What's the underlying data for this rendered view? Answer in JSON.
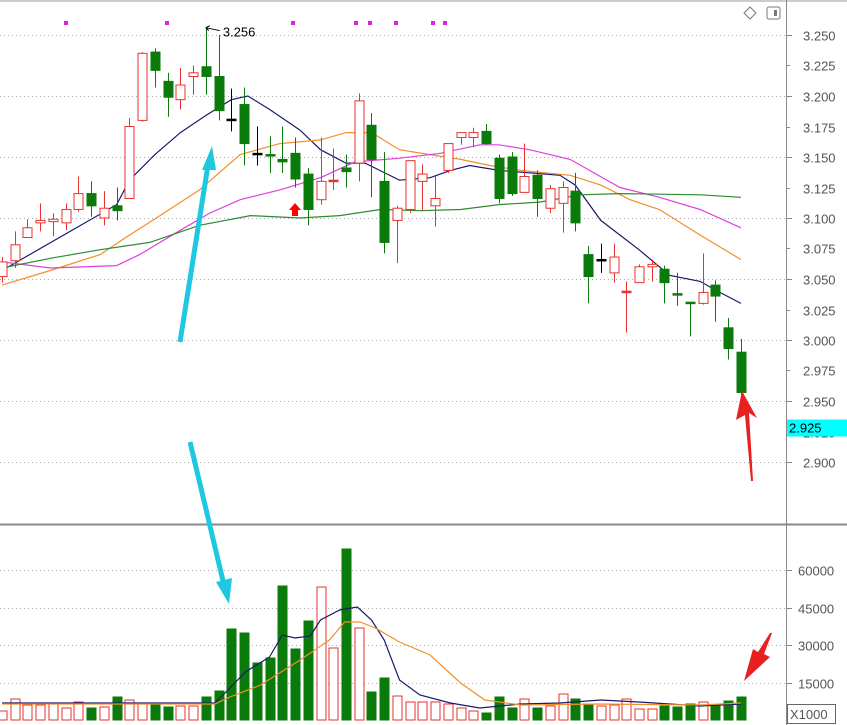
{
  "chart_data": {
    "type": "candlestick",
    "price_axis": {
      "ylim": [
        2.862,
        3.279
      ],
      "ticks": [
        "3.250",
        "3.225",
        "3.200",
        "3.175",
        "3.150",
        "3.125",
        "3.100",
        "3.075",
        "3.050",
        "3.025",
        "3.000",
        "2.975",
        "2.950",
        "2.925",
        "2.900"
      ],
      "grid_every": 0.05
    },
    "current_price_label": "2.925",
    "current_price_value": 2.925,
    "high_marker": {
      "label": "3.256",
      "index": 16,
      "value": 3.256
    },
    "colors": {
      "up": "#e8322e",
      "down": "#0a7a0a",
      "doji": "#000000",
      "ma5": "#1a1a6e",
      "ma10": "#f0902a",
      "ma20": "#e040e0",
      "ma60": "#2e8b2e",
      "current_price_bg": "#00ffff",
      "annotation_arrow": "#1ec8e0",
      "red_arrow": "#e82020",
      "marker_dot": "#e020e0"
    },
    "candles": [
      [
        3.052,
        3.068,
        3.047,
        3.064
      ],
      [
        3.065,
        3.089,
        3.059,
        3.078
      ],
      [
        3.084,
        3.099,
        3.084,
        3.092
      ],
      [
        3.096,
        3.112,
        3.089,
        3.098
      ],
      [
        3.097,
        3.104,
        3.085,
        3.099
      ],
      [
        3.096,
        3.112,
        3.09,
        3.107
      ],
      [
        3.107,
        3.134,
        3.105,
        3.12
      ],
      [
        3.12,
        3.13,
        3.101,
        3.11
      ],
      [
        3.1,
        3.122,
        3.094,
        3.108
      ],
      [
        3.11,
        3.125,
        3.098,
        3.106
      ],
      [
        3.116,
        3.182,
        3.116,
        3.175
      ],
      [
        3.18,
        3.236,
        3.179,
        3.235
      ],
      [
        3.236,
        3.239,
        3.207,
        3.221
      ],
      [
        3.212,
        3.219,
        3.183,
        3.199
      ],
      [
        3.197,
        3.223,
        3.189,
        3.209
      ],
      [
        3.216,
        3.225,
        3.201,
        3.219
      ],
      [
        3.224,
        3.256,
        3.201,
        3.216
      ],
      [
        3.216,
        3.25,
        3.18,
        3.188
      ],
      [
        3.181,
        3.206,
        3.171,
        3.181
      ],
      [
        3.193,
        3.207,
        3.143,
        3.161
      ],
      [
        3.153,
        3.175,
        3.143,
        3.153
      ],
      [
        3.152,
        3.167,
        3.137,
        3.151
      ],
      [
        3.148,
        3.175,
        3.137,
        3.146
      ],
      [
        3.153,
        3.166,
        3.125,
        3.132
      ],
      [
        3.136,
        3.141,
        3.094,
        3.107
      ],
      [
        3.115,
        3.166,
        3.111,
        3.13
      ],
      [
        3.131,
        3.157,
        3.123,
        3.131
      ],
      [
        3.141,
        3.152,
        3.125,
        3.138
      ],
      [
        3.145,
        3.202,
        3.13,
        3.196
      ],
      [
        3.176,
        3.186,
        3.117,
        3.148
      ],
      [
        3.13,
        3.154,
        3.071,
        3.08
      ],
      [
        3.098,
        3.11,
        3.063,
        3.108
      ],
      [
        3.107,
        3.147,
        3.104,
        3.147
      ],
      [
        3.13,
        3.144,
        3.106,
        3.136
      ],
      [
        3.11,
        3.134,
        3.093,
        3.116
      ],
      [
        3.139,
        3.161,
        3.137,
        3.161
      ],
      [
        3.166,
        3.17,
        3.16,
        3.17
      ],
      [
        3.166,
        3.174,
        3.158,
        3.17
      ],
      [
        3.171,
        3.177,
        3.16,
        3.161
      ],
      [
        3.149,
        3.152,
        3.112,
        3.116
      ],
      [
        3.15,
        3.154,
        3.118,
        3.12
      ],
      [
        3.121,
        3.161,
        3.121,
        3.134
      ],
      [
        3.135,
        3.139,
        3.101,
        3.116
      ],
      [
        3.108,
        3.127,
        3.104,
        3.124
      ],
      [
        3.112,
        3.13,
        3.088,
        3.125
      ],
      [
        3.122,
        3.137,
        3.089,
        3.096
      ],
      [
        3.07,
        3.077,
        3.03,
        3.052
      ],
      [
        3.066,
        3.079,
        3.055,
        3.066
      ],
      [
        3.055,
        3.079,
        3.047,
        3.068
      ],
      [
        3.039,
        3.048,
        3.006,
        3.04
      ],
      [
        3.047,
        3.062,
        3.047,
        3.06
      ],
      [
        3.06,
        3.066,
        3.048,
        3.062
      ],
      [
        3.058,
        3.061,
        3.03,
        3.047
      ],
      [
        3.038,
        3.055,
        3.028,
        3.037
      ],
      [
        3.031,
        3.031,
        3.003,
        3.03
      ],
      [
        3.03,
        3.071,
        3.029,
        3.039
      ],
      [
        3.045,
        3.049,
        3.015,
        3.036
      ],
      [
        3.01,
        3.018,
        2.984,
        2.993
      ],
      [
        2.99,
        3.001,
        2.955,
        2.957
      ]
    ],
    "moving_averages": [
      {
        "name": "MA5",
        "points": [
          [
            0,
            3.057
          ],
          [
            9,
            3.111
          ],
          [
            10,
            3.131
          ],
          [
            12,
            3.152
          ],
          [
            14,
            3.17
          ],
          [
            16,
            3.184
          ],
          [
            18,
            3.197
          ],
          [
            19.3,
            3.2
          ],
          [
            21,
            3.189
          ],
          [
            23.4,
            3.172
          ],
          [
            25,
            3.156
          ],
          [
            27,
            3.145
          ],
          [
            28.5,
            3.145
          ],
          [
            31.2,
            3.131
          ],
          [
            33.6,
            3.133
          ],
          [
            35.2,
            3.139
          ],
          [
            36.7,
            3.143
          ],
          [
            39,
            3.139
          ],
          [
            43.8,
            3.135
          ],
          [
            45,
            3.127
          ],
          [
            47,
            3.098
          ],
          [
            50,
            3.074
          ],
          [
            52.4,
            3.053
          ],
          [
            54.8,
            3.048
          ],
          [
            56,
            3.041
          ],
          [
            58,
            3.03
          ]
        ]
      },
      {
        "name": "MA10",
        "points": [
          [
            0,
            3.045
          ],
          [
            3.8,
            3.057
          ],
          [
            7.7,
            3.07
          ],
          [
            10,
            3.086
          ],
          [
            12.4,
            3.102
          ],
          [
            15.5,
            3.123
          ],
          [
            18.7,
            3.152
          ],
          [
            21.8,
            3.161
          ],
          [
            25,
            3.164
          ],
          [
            27,
            3.17
          ],
          [
            29,
            3.17
          ],
          [
            31.2,
            3.156
          ],
          [
            33.6,
            3.152
          ],
          [
            36,
            3.148
          ],
          [
            38.3,
            3.143
          ],
          [
            40.7,
            3.139
          ],
          [
            44.6,
            3.135
          ],
          [
            47,
            3.127
          ],
          [
            49.3,
            3.115
          ],
          [
            51.6,
            3.107
          ],
          [
            54.8,
            3.086
          ],
          [
            58,
            3.066
          ]
        ]
      },
      {
        "name": "MA20",
        "points": [
          [
            0,
            3.064
          ],
          [
            3.8,
            3.059
          ],
          [
            9,
            3.061
          ],
          [
            10.8,
            3.07
          ],
          [
            14,
            3.09
          ],
          [
            16.3,
            3.104
          ],
          [
            18.7,
            3.115
          ],
          [
            21.8,
            3.123
          ],
          [
            25,
            3.133
          ],
          [
            27.7,
            3.146
          ],
          [
            31.2,
            3.149
          ],
          [
            34.4,
            3.153
          ],
          [
            37.5,
            3.16
          ],
          [
            39,
            3.16
          ],
          [
            41.4,
            3.156
          ],
          [
            44.6,
            3.148
          ],
          [
            48.5,
            3.125
          ],
          [
            51.6,
            3.117
          ],
          [
            54.8,
            3.107
          ],
          [
            58,
            3.092
          ]
        ]
      },
      {
        "name": "MA60",
        "points": [
          [
            0,
            3.059
          ],
          [
            3.8,
            3.067
          ],
          [
            7.7,
            3.074
          ],
          [
            11.6,
            3.08
          ],
          [
            15.5,
            3.094
          ],
          [
            19.5,
            3.102
          ],
          [
            23.4,
            3.1
          ],
          [
            26.5,
            3.102
          ],
          [
            29.7,
            3.107
          ],
          [
            32.8,
            3.106
          ],
          [
            36,
            3.107
          ],
          [
            39,
            3.111
          ],
          [
            42.2,
            3.113
          ],
          [
            45.4,
            3.119
          ],
          [
            48.5,
            3.12
          ],
          [
            54.8,
            3.119
          ],
          [
            58,
            3.117
          ]
        ]
      }
    ],
    "volume": {
      "unit_label": "X1000",
      "ylim": [
        0,
        72000
      ],
      "ticks": [
        "60000",
        "45000",
        "30000",
        "15000"
      ],
      "tick_values": [
        60000,
        45000,
        30000,
        15000
      ],
      "values": [
        3600,
        8400,
        6000,
        6000,
        6400,
        4800,
        7200,
        4800,
        5200,
        9200,
        8000,
        6400,
        6800,
        5200,
        5600,
        5600,
        9200,
        11600,
        36400,
        34800,
        22800,
        24800,
        53600,
        28400,
        39600,
        53200,
        28800,
        68400,
        36800,
        11200,
        16800,
        9600,
        7200,
        7200,
        7200,
        6400,
        4800,
        3600,
        2800,
        9200,
        4800,
        8400,
        4800,
        5600,
        10400,
        8400,
        6400,
        5600,
        6000,
        8400,
        4400,
        4400,
        5600,
        5200,
        6400,
        7200,
        5600,
        7600,
        9200
      ],
      "up": [
        1,
        1,
        1,
        1,
        1,
        1,
        1,
        0,
        1,
        0,
        1,
        1,
        0,
        0,
        1,
        1,
        0,
        0,
        0,
        0,
        0,
        0,
        0,
        0,
        0,
        1,
        1,
        0,
        1,
        0,
        0,
        1,
        1,
        1,
        1,
        1,
        1,
        1,
        0,
        0,
        0,
        1,
        0,
        1,
        1,
        0,
        0,
        1,
        1,
        1,
        1,
        1,
        0,
        0,
        0,
        1,
        0,
        0,
        0
      ],
      "ma_lines": [
        {
          "name": "VOL-MA5",
          "points": [
            [
              0,
              6800
            ],
            [
              16.7,
              6800
            ],
            [
              17.9,
              12800
            ],
            [
              19.1,
              19200
            ],
            [
              21,
              25200
            ],
            [
              22,
              34000
            ],
            [
              23,
              32800
            ],
            [
              24.2,
              33600
            ],
            [
              25,
              40000
            ],
            [
              26.5,
              44000
            ],
            [
              27.9,
              45200
            ],
            [
              29,
              40000
            ],
            [
              30,
              32000
            ],
            [
              31.2,
              16000
            ],
            [
              32.8,
              10000
            ],
            [
              35.2,
              6800
            ],
            [
              37.5,
              4800
            ],
            [
              40.7,
              6400
            ],
            [
              43.8,
              6800
            ],
            [
              47,
              8000
            ],
            [
              50,
              7200
            ],
            [
              54.8,
              5600
            ],
            [
              58,
              6400
            ]
          ]
        },
        {
          "name": "VOL-MA10",
          "points": [
            [
              0,
              6400
            ],
            [
              16.7,
              6400
            ],
            [
              17.9,
              9200
            ],
            [
              20.3,
              14000
            ],
            [
              23.4,
              24000
            ],
            [
              25.7,
              32000
            ],
            [
              26.9,
              39200
            ],
            [
              28.1,
              39200
            ],
            [
              29.3,
              36800
            ],
            [
              31.2,
              31200
            ],
            [
              33.6,
              26000
            ],
            [
              36,
              14800
            ],
            [
              37.9,
              8000
            ],
            [
              40.7,
              6000
            ],
            [
              47,
              6400
            ],
            [
              54.8,
              6000
            ],
            [
              58,
              6800
            ]
          ]
        }
      ]
    },
    "signal_marker_indices": [
      5,
      13,
      23,
      28,
      29,
      31,
      34,
      35
    ],
    "buy_arrow_index": 23
  }
}
